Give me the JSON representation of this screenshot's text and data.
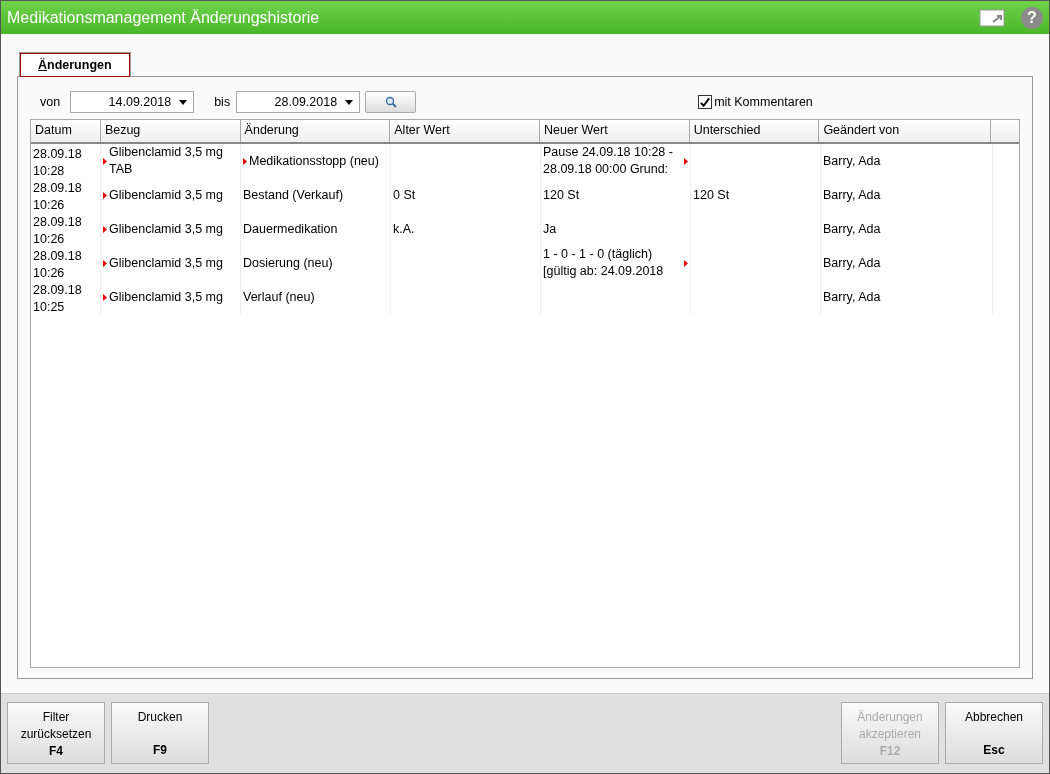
{
  "window": {
    "title": "Medikationsmanagement Änderungshistorie",
    "help": "?"
  },
  "tabs": [
    {
      "label": "Änderungen",
      "selected": true
    }
  ],
  "filter": {
    "from_label": "von",
    "from_value": "14.09.2018",
    "to_label": "bis",
    "to_value": "28.09.2018",
    "comments": {
      "label": "mit Kommentaren",
      "checked": true
    }
  },
  "table": {
    "columns": [
      "Datum",
      "Bezug",
      "Änderung",
      "Alter Wert",
      "Neuer Wert",
      "Unterschied",
      "Geändert von"
    ],
    "rows": [
      {
        "cells": [
          {
            "text": "28.09.18 10:28",
            "more": false
          },
          {
            "text": "Glibenclamid 3,5 mg TAB",
            "more": true
          },
          {
            "text": "Medikationsstopp (neu)",
            "more": true
          },
          {
            "more": false
          },
          {
            "text": "Pause 24.09.18 10:28 - 28.09.18 00:00 Grund:",
            "more": true
          },
          {
            "more": false
          },
          {
            "text": "Barry, Ada",
            "more": false
          }
        ]
      },
      {
        "cells": [
          {
            "text": "28.09.18 10:26",
            "more": false
          },
          {
            "text": "Glibenclamid 3,5 mg",
            "more": true
          },
          {
            "text": "Bestand (Verkauf)",
            "more": false
          },
          {
            "text": "0 St",
            "more": false
          },
          {
            "text": "120 St",
            "more": false
          },
          {
            "text": "120 St",
            "more": false
          },
          {
            "text": "Barry, Ada",
            "more": false
          }
        ]
      },
      {
        "cells": [
          {
            "text": "28.09.18 10:26",
            "more": false
          },
          {
            "text": "Glibenclamid 3,5 mg",
            "more": true
          },
          {
            "text": "Dauermedikation",
            "more": false
          },
          {
            "text": "k.A.",
            "more": false
          },
          {
            "text": "Ja",
            "more": false
          },
          {
            "more": false
          },
          {
            "text": "Barry, Ada",
            "more": false
          }
        ]
      },
      {
        "cells": [
          {
            "text": "28.09.18 10:26",
            "more": false
          },
          {
            "text": "Glibenclamid 3,5 mg",
            "more": true
          },
          {
            "text": "Dosierung (neu)",
            "more": false
          },
          {
            "more": false
          },
          {
            "text": "1 - 0 - 1 - 0 (täglich) [gültig ab: 24.09.2018",
            "more": true
          },
          {
            "more": false
          },
          {
            "text": "Barry, Ada",
            "more": false
          }
        ]
      },
      {
        "cells": [
          {
            "text": "28.09.18 10:25",
            "more": false
          },
          {
            "text": "Glibenclamid 3,5 mg",
            "more": true
          },
          {
            "text": "Verlauf (neu)",
            "more": false
          },
          {
            "more": false
          },
          {
            "more": false
          },
          {
            "more": false
          },
          {
            "text": "Barry, Ada",
            "more": false
          }
        ]
      }
    ]
  },
  "buttons_left": [
    {
      "label": "Filter zurücksetzen",
      "key": "F4",
      "disabled": false
    },
    {
      "label": "Drucken",
      "key": "F9",
      "disabled": false
    }
  ],
  "buttons_right": [
    {
      "label": "Änderungen akzeptieren",
      "key": "F12",
      "disabled": true
    },
    {
      "label": "Abbrechen",
      "key": "Esc",
      "disabled": false
    }
  ]
}
